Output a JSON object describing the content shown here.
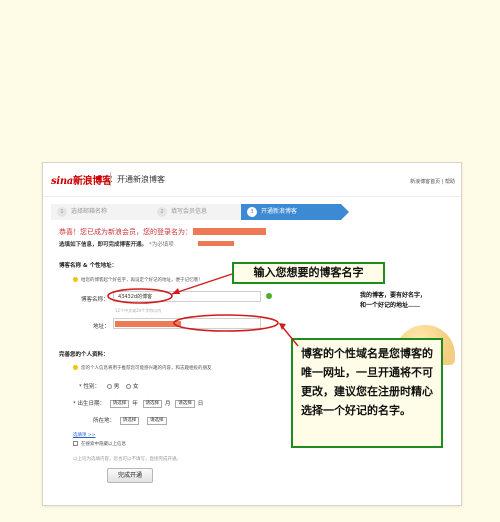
{
  "header": {
    "logo_brand": "sina",
    "logo_text": "新浪博客",
    "page_title": "开通新浪博客",
    "top_links": "新浪博客首页 | 帮助"
  },
  "steps": [
    {
      "num": "1",
      "label": "选择邮箱名称"
    },
    {
      "num": "2",
      "label": "填写会员信息"
    },
    {
      "num": "3",
      "label": "开通新浪博客"
    }
  ],
  "intro": {
    "congrats": "恭喜！您已成为新浪会员，您的登录名为：",
    "fill_hint": "选填如下信息，即可完成博客开通。",
    "fill_sub": "*为必填项"
  },
  "blog_section": {
    "title": "博客名称 & 个性地址：",
    "tip": "给您的博客起个好名字，再设定个好记的地址，便于记忆哦！",
    "name_label": "博客名称：",
    "name_value": "43432d的博客",
    "count_hint": "12个中文或24个字符以内",
    "address_label": "地址："
  },
  "personal_section": {
    "title": "完善您的个人资料：",
    "tip": "您的个人信息将用于推荐您可能感兴趣的内容，和志趣相投的朋友",
    "gender_label": "* 性别：",
    "gender_male": "男",
    "gender_female": "女",
    "birth_label": "* 出生日期：",
    "select_placeholder": "请选择",
    "year_unit": "年",
    "month_unit": "月",
    "day_unit": "日",
    "location_label": "所在地：",
    "more_link": "选填项 >>",
    "checkbox_label": "在搜索中隐藏以上信息",
    "footer_note": "以上均为选填内容，您也可以不填写，直接完成开通。",
    "submit_label": "完成开通"
  },
  "annotations": {
    "callout_name": "输入您想要的博客名字",
    "side_note_line1": "我的博客，要有好名字，",
    "side_note_line2": "和一个好记的地址……",
    "callout_address": "博客的个性域名是您博客的唯一网址，一旦开通将不可更改，建议您在注册时精心选择一个好记的名字。"
  },
  "colors": {
    "step_active": "#3c8ad4",
    "annotation_border": "#1e8c1e",
    "highlight_red": "#d01c1c",
    "sina_red": "#cc0000"
  }
}
